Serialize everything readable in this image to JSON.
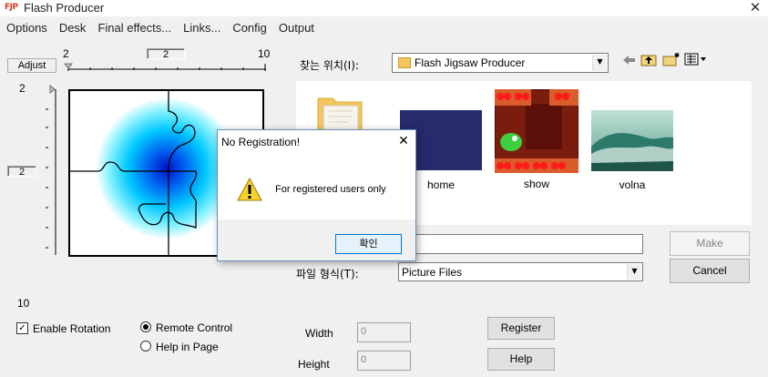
{
  "window": {
    "icon_text": "FJP",
    "title": "Flash Producer",
    "close_glyph": "✕"
  },
  "menu": [
    "Options",
    "Desk",
    "Final effects...",
    "Links...",
    "Config",
    "Output"
  ],
  "adjust": {
    "button_label": "Adjust",
    "h_min": "2",
    "h_value": "2",
    "h_max": "10",
    "v_min": "2",
    "v_value": "2",
    "v_max": "10"
  },
  "file_dialog": {
    "look_in_label": "찾는 위치(I):",
    "look_in_value": "Flash Jigsaw Producer",
    "files": [
      {
        "name": "",
        "icon": "folder-icon"
      },
      {
        "name": "home",
        "icon": "image-thumbnail"
      },
      {
        "name": "show",
        "icon": "image-thumbnail"
      },
      {
        "name": "volna",
        "icon": "image-thumbnail"
      }
    ],
    "file_name_value": "",
    "file_type_label": "파일 형식(T):",
    "file_type_value": "Picture Files",
    "make_label": "Make",
    "cancel_label": "Cancel"
  },
  "options": {
    "enable_rotation_label": "Enable Rotation",
    "enable_rotation_checked": true,
    "remote_control_label": "Remote Control",
    "help_in_page_label": "Help in Page",
    "selected_mode": "Remote Control"
  },
  "size": {
    "width_label": "Width",
    "width_value": "0",
    "height_label": "Height",
    "height_value": "0"
  },
  "buttons": {
    "register_label": "Register",
    "help_label": "Help"
  },
  "modal": {
    "title": "No Registration!",
    "message": "For registered users only",
    "ok_label": "확인",
    "close_glyph": "✕"
  },
  "colors": {
    "accent": "#0078d7",
    "blob_center": "#0000c8",
    "blob_edge": "#00e5ff"
  }
}
